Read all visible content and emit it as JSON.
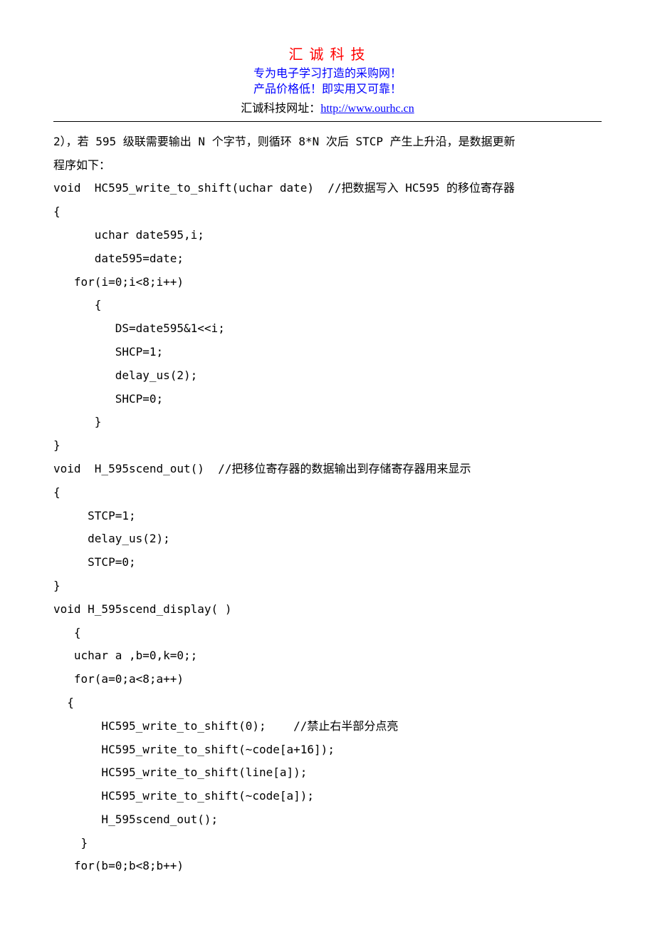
{
  "header": {
    "title": "汇 诚 科 技",
    "subtitle1": "专为电子学习打造的采购网！",
    "subtitle2": "产品价格低！即实用又可靠！",
    "urlLabel": "汇诚科技网址：",
    "url": "http://www.ourhc.cn"
  },
  "lines": [
    "2），若 595 级联需要输出 N 个字节，则循环 8*N 次后 STCP 产生上升沿，是数据更新",
    "程序如下：",
    "void  HC595_write_to_shift(uchar date)  //把数据写入 HC595 的移位寄存器",
    "{",
    "      uchar date595,i;",
    "      date595=date;",
    "   for(i=0;i<8;i++)",
    "      {",
    "         DS=date595&1<<i;",
    "         SHCP=1;",
    "         delay_us(2);",
    "         SHCP=0;",
    "      }",
    "}",
    "void  H_595scend_out()  //把移位寄存器的数据输出到存储寄存器用来显示",
    "{",
    "     STCP=1;",
    "     delay_us(2);",
    "     STCP=0;",
    "}",
    "void H_595scend_display( )",
    "   {",
    "   uchar a ,b=0,k=0;;",
    "   for(a=0;a<8;a++)",
    "  {",
    "       HC595_write_to_shift(0);    //禁止右半部分点亮",
    "       HC595_write_to_shift(~code[a+16]);",
    "       HC595_write_to_shift(line[a]);",
    "       HC595_write_to_shift(~code[a]);",
    "       H_595scend_out();",
    "    }",
    "   for(b=0;b<8;b++)"
  ]
}
